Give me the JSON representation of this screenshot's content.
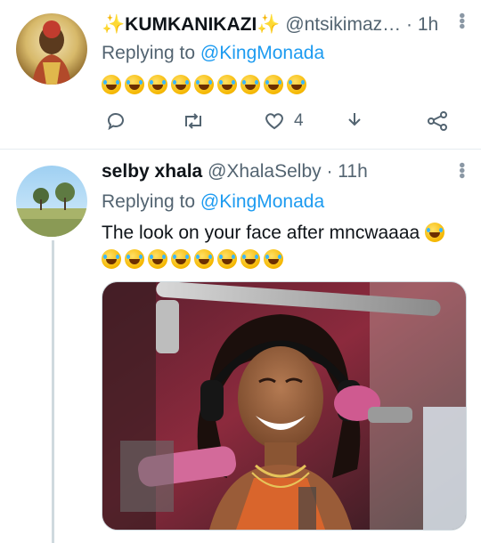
{
  "tweets": [
    {
      "display_name": "KUMKANIKAZI",
      "name_decoration": "✨",
      "handle": "@ntsikimaz…",
      "time": "· 1h",
      "replying_prefix": "Replying to",
      "replying_to": "@KingMonada",
      "emoji_count": 9,
      "actions": {
        "reply_count": "",
        "retweet_count": "",
        "like_count": "4"
      }
    },
    {
      "display_name": "selby xhala",
      "handle": "@XhalaSelby",
      "time": "· 11h",
      "replying_prefix": "Replying to",
      "replying_to": "@KingMonada",
      "text": "The look on your face after mncwaaaa",
      "emoji_count_line1": 1,
      "emoji_count_line2": 8
    }
  ],
  "colors": {
    "accent": "#1d9bf0",
    "muted": "#536471",
    "divider": "#e6ecf0"
  }
}
